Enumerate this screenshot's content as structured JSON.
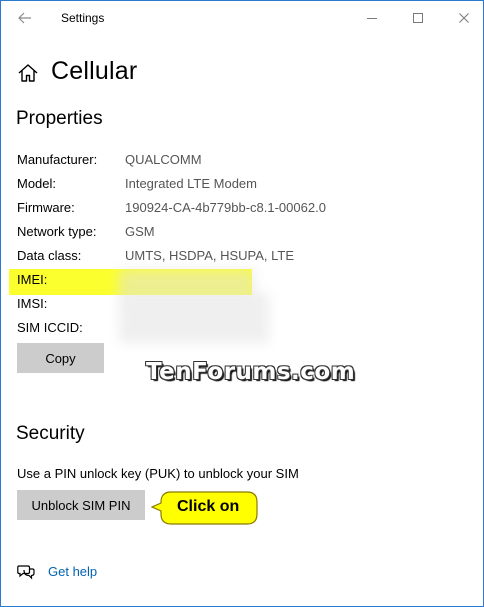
{
  "window": {
    "title": "Settings"
  },
  "page": {
    "title": "Cellular"
  },
  "properties": {
    "heading": "Properties",
    "rows": [
      {
        "label": "Manufacturer:",
        "value": "QUALCOMM"
      },
      {
        "label": "Model:",
        "value": "Integrated LTE Modem"
      },
      {
        "label": "Firmware:",
        "value": "190924-CA-4b779bb-c8.1-00062.0"
      },
      {
        "label": "Network type:",
        "value": "GSM"
      },
      {
        "label": "Data class:",
        "value": "UMTS, HSDPA, HSUPA, LTE"
      },
      {
        "label": "IMEI:",
        "value": ""
      },
      {
        "label": "IMSI:",
        "value": ""
      },
      {
        "label": "SIM ICCID:",
        "value": ""
      }
    ],
    "copy_label": "Copy"
  },
  "watermark": "TenForums.com",
  "security": {
    "heading": "Security",
    "description": "Use a PIN unlock key (PUK) to unblock your SIM",
    "unblock_label": "Unblock SIM PIN"
  },
  "callout": {
    "text": "Click on"
  },
  "help": {
    "label": "Get help"
  },
  "colors": {
    "highlight": "#fbff2e",
    "callout_fill": "#ffff00",
    "link": "#0063b1",
    "button": "#cccccc"
  }
}
